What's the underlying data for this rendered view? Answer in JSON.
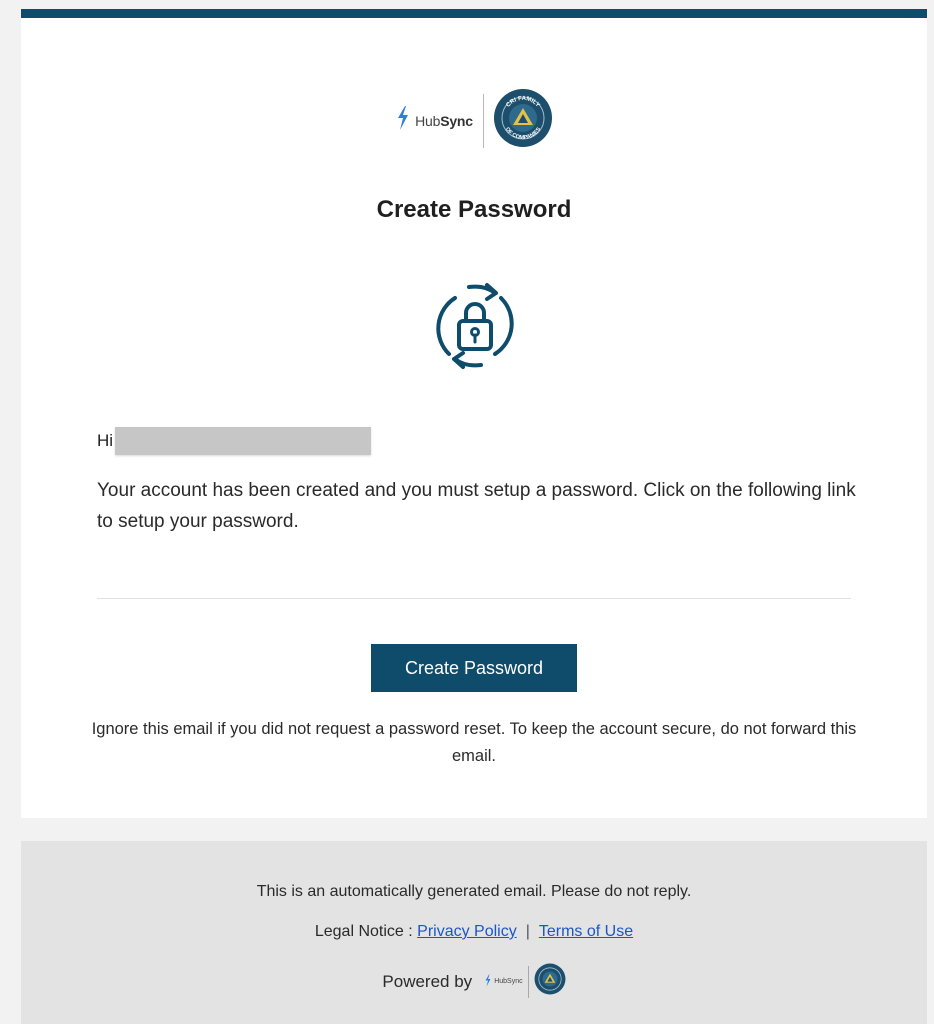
{
  "header": {
    "brand_name_light": "Hub",
    "brand_name_bold": "Sync",
    "partner_logo_text_top": "CRI FAMILY",
    "partner_logo_text_bottom": "OF COMPANIES"
  },
  "main": {
    "title": "Create Password",
    "greeting_prefix": "Hi c",
    "message": "Your account has been created and you must setup a password. Click on the following link to setup your password.",
    "button_label": "Create Password",
    "note": "Ignore this email if you did not request a password reset. To keep the account secure, do not forward this email."
  },
  "footer": {
    "auto_text": "This is an automatically generated email. Please do not reply.",
    "legal_label": "Legal Notice : ",
    "privacy_link": "Privacy Policy",
    "separator": "|",
    "terms_link": "Terms of Use",
    "powered_by": "Powered by",
    "mini_brand": "HubSync"
  },
  "colors": {
    "accent": "#0f4c6b",
    "brand_blue": "#2f7de1",
    "link": "#1a56c9",
    "footer_bg": "#e3e3e3",
    "page_bg": "#f2f2f2"
  },
  "icons": {
    "brand": "hubsync-bolt-icon",
    "partner": "cri-seal-icon",
    "hero": "lock-refresh-icon"
  }
}
